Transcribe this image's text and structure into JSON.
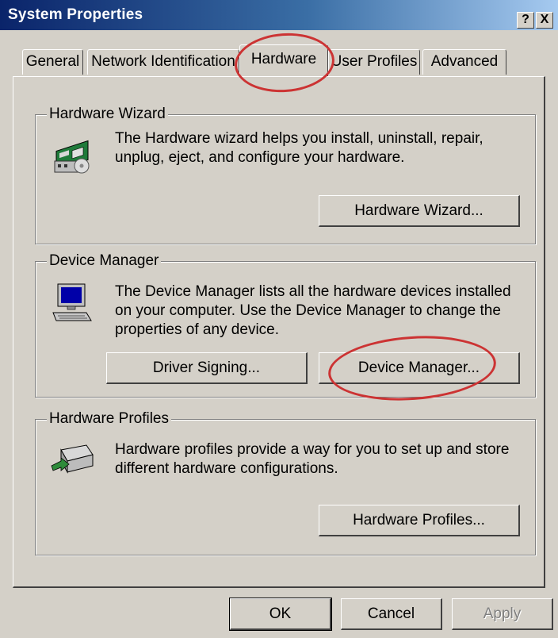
{
  "window": {
    "title": "System Properties",
    "help_label": "?",
    "close_label": "X"
  },
  "tabs": [
    {
      "label": "General"
    },
    {
      "label": "Network Identification"
    },
    {
      "label": "Hardware",
      "active": true
    },
    {
      "label": "User Profiles"
    },
    {
      "label": "Advanced"
    }
  ],
  "hardware_wizard": {
    "group_label": "Hardware Wizard",
    "description_line1": "The Hardware wizard helps you install, uninstall, repair,",
    "description_line2": "unplug, eject, and configure your hardware.",
    "button": "Hardware Wizard...",
    "icon": "hardware-wizard-icon"
  },
  "device_manager": {
    "group_label": "Device Manager",
    "description_line1": "The Device Manager lists all the hardware devices installed",
    "description_line2": "on your computer. Use the Device Manager to change the",
    "description_line3": "properties of any device.",
    "driver_signing_button": "Driver Signing...",
    "device_manager_button": "Device Manager...",
    "icon": "computer-icon"
  },
  "hardware_profiles": {
    "group_label": "Hardware Profiles",
    "description_line1": "Hardware profiles provide a way for you to set up and store",
    "description_line2": "different hardware configurations.",
    "button": "Hardware Profiles...",
    "icon": "hardware-profiles-icon"
  },
  "footer": {
    "ok": "OK",
    "cancel": "Cancel",
    "apply": "Apply",
    "apply_disabled": true
  },
  "colors": {
    "face": "#d4d0c8",
    "title_start": "#0a246a",
    "title_end": "#a6caf0",
    "annotation_circle": "#cc3333"
  }
}
